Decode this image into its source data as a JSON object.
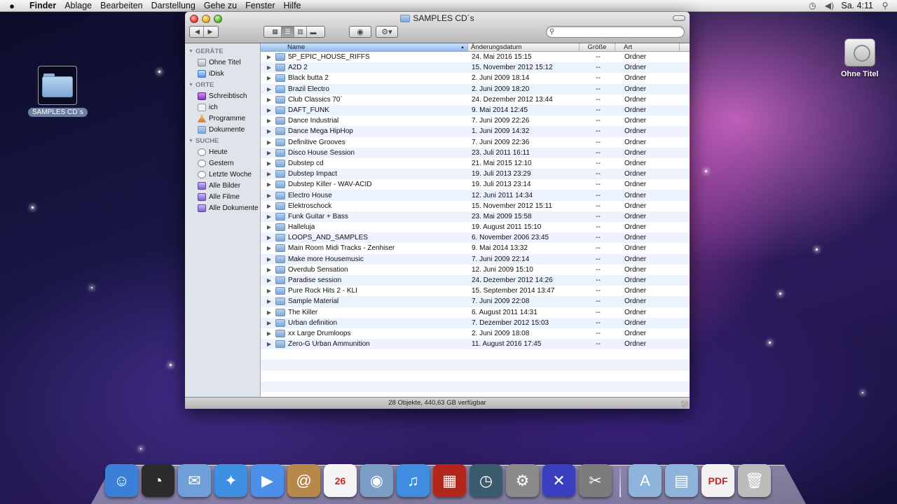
{
  "menubar": {
    "app_name": "Finder",
    "menus": [
      "Ablage",
      "Bearbeiten",
      "Darstellung",
      "Gehe zu",
      "Fenster",
      "Hilfe"
    ],
    "clock": "Sa. 4:11"
  },
  "desktop": {
    "folder_label": "SAMPLES CD´s",
    "disk_label": "Ohne Titel"
  },
  "window": {
    "title": "SAMPLES CD´s",
    "search": {
      "value": "",
      "placeholder": ""
    },
    "status": "28 Objekte, 440,63 GB verfügbar"
  },
  "sidebar": {
    "sections": [
      {
        "title": "GERÄTE",
        "items": [
          {
            "label": "Ohne Titel",
            "icon": "disk-icon"
          },
          {
            "label": "iDisk",
            "icon": "idisk-icon"
          }
        ]
      },
      {
        "title": "ORTE",
        "items": [
          {
            "label": "Schreibtisch",
            "icon": "desktop-icon"
          },
          {
            "label": "ich",
            "icon": "home-icon"
          },
          {
            "label": "Programme",
            "icon": "applications-icon"
          },
          {
            "label": "Dokumente",
            "icon": "documents-icon"
          }
        ]
      },
      {
        "title": "SUCHE",
        "items": [
          {
            "label": "Heute",
            "icon": "clock-icon"
          },
          {
            "label": "Gestern",
            "icon": "clock-icon"
          },
          {
            "label": "Letzte Woche",
            "icon": "clock-icon"
          },
          {
            "label": "Alle Bilder",
            "icon": "smart-folder-icon"
          },
          {
            "label": "Alle Filme",
            "icon": "smart-folder-icon"
          },
          {
            "label": "Alle Dokumente",
            "icon": "smart-folder-icon"
          }
        ]
      }
    ]
  },
  "list": {
    "columns": {
      "name": "Name",
      "date": "Änderungsdatum",
      "size": "Größe",
      "kind": "Art"
    },
    "rows": [
      {
        "name": "5P_EPIC_HOUSE_RIFFS",
        "date": "24. Mai 2016 15:15",
        "size": "--",
        "kind": "Ordner"
      },
      {
        "name": "A2D 2",
        "date": "15. November 2012 15:12",
        "size": "--",
        "kind": "Ordner"
      },
      {
        "name": "Black butta 2",
        "date": "2. Juni 2009 18:14",
        "size": "--",
        "kind": "Ordner"
      },
      {
        "name": "Brazil Electro",
        "date": "2. Juni 2009 18:20",
        "size": "--",
        "kind": "Ordner"
      },
      {
        "name": "Club Classics 70´",
        "date": "24. Dezember 2012 13:44",
        "size": "--",
        "kind": "Ordner"
      },
      {
        "name": "DAFT_FUNK",
        "date": "9. Mai 2014 12:45",
        "size": "--",
        "kind": "Ordner"
      },
      {
        "name": "Dance Industrial",
        "date": "7. Juni 2009 22:26",
        "size": "--",
        "kind": "Ordner"
      },
      {
        "name": "Dance Mega HipHop",
        "date": "1. Juni 2009 14:32",
        "size": "--",
        "kind": "Ordner"
      },
      {
        "name": "Definitive Grooves",
        "date": "7. Juni 2009 22:36",
        "size": "--",
        "kind": "Ordner"
      },
      {
        "name": "Disco House Session",
        "date": "23. Juli 2011 16:11",
        "size": "--",
        "kind": "Ordner"
      },
      {
        "name": "Dubstep cd",
        "date": "21. Mai 2015 12:10",
        "size": "--",
        "kind": "Ordner"
      },
      {
        "name": "Dubstep Impact",
        "date": "19. Juli 2013 23:29",
        "size": "--",
        "kind": "Ordner"
      },
      {
        "name": "Dubstep Killer - WAV-ACID",
        "date": "19. Juli 2013 23:14",
        "size": "--",
        "kind": "Ordner"
      },
      {
        "name": "Electro House",
        "date": "12. Juni 2011 14:34",
        "size": "--",
        "kind": "Ordner"
      },
      {
        "name": "Elektroschock",
        "date": "15. November 2012 15:11",
        "size": "--",
        "kind": "Ordner"
      },
      {
        "name": "Funk Guitar + Bass",
        "date": "23. Mai 2009 15:58",
        "size": "--",
        "kind": "Ordner"
      },
      {
        "name": "Halleluja",
        "date": "19. August 2011 15:10",
        "size": "--",
        "kind": "Ordner"
      },
      {
        "name": "LOOPS_AND_SAMPLES",
        "date": "6. November 2006 23:45",
        "size": "--",
        "kind": "Ordner"
      },
      {
        "name": "Main Room Midi Tracks - Zenhiser",
        "date": "9. Mai 2014 13:32",
        "size": "--",
        "kind": "Ordner"
      },
      {
        "name": "Make  more Housemusic",
        "date": "7. Juni 2009 22:14",
        "size": "--",
        "kind": "Ordner"
      },
      {
        "name": "Overdub Sensation",
        "date": "12. Juni 2009 15:10",
        "size": "--",
        "kind": "Ordner"
      },
      {
        "name": "Paradise session",
        "date": "24. Dezember 2012 14:26",
        "size": "--",
        "kind": "Ordner"
      },
      {
        "name": "Pure Rock Hits 2 - KLI",
        "date": "15. September 2014 13:47",
        "size": "--",
        "kind": "Ordner"
      },
      {
        "name": "Sample Material",
        "date": "7. Juni 2009 22:08",
        "size": "--",
        "kind": "Ordner"
      },
      {
        "name": "The Killer",
        "date": "6. August 2011 14:31",
        "size": "--",
        "kind": "Ordner"
      },
      {
        "name": "Urban definition",
        "date": "7. Dezember 2012 15:03",
        "size": "--",
        "kind": "Ordner"
      },
      {
        "name": "xx Large Drumloops",
        "date": "2. Juni 2009 18:08",
        "size": "--",
        "kind": "Ordner"
      },
      {
        "name": "Zero-G Urban Ammunition",
        "date": "11. August 2016 17:45",
        "size": "--",
        "kind": "Ordner"
      }
    ]
  },
  "dock": {
    "apps": [
      {
        "icon": "finder-icon",
        "glyph": "☺",
        "color": "#3c7fd6"
      },
      {
        "icon": "dashboard-icon",
        "glyph": "◔",
        "color": "#2b2b2b"
      },
      {
        "icon": "mail-icon",
        "glyph": "✉",
        "color": "#6f9fd8"
      },
      {
        "icon": "safari-icon",
        "glyph": "✦",
        "color": "#3d8fe0"
      },
      {
        "icon": "ichat-icon",
        "glyph": "▶",
        "color": "#4b8fe8"
      },
      {
        "icon": "address-book-icon",
        "glyph": "@",
        "color": "#b8874a"
      },
      {
        "icon": "ical-icon",
        "glyph": "26",
        "color": "#f4f4f4"
      },
      {
        "icon": "iphoto-icon",
        "glyph": "◉",
        "color": "#7a9ec4"
      },
      {
        "icon": "itunes-icon",
        "glyph": "♫",
        "color": "#3e8de0"
      },
      {
        "icon": "photo-booth-icon",
        "glyph": "▦",
        "color": "#b3261c"
      },
      {
        "icon": "time-machine-icon",
        "glyph": "◷",
        "color": "#3a5a6e"
      },
      {
        "icon": "system-preferences-icon",
        "glyph": "⚙",
        "color": "#8a8a8a"
      },
      {
        "icon": "vise-icon",
        "glyph": "✕",
        "color": "#3b3fbf"
      },
      {
        "icon": "utility-icon",
        "glyph": "✂",
        "color": "#7c7c7c"
      }
    ],
    "stacks": [
      {
        "icon": "applications-stack-icon",
        "glyph": "A",
        "color": "#8fb4dc"
      },
      {
        "icon": "documents-stack-icon",
        "glyph": "▤",
        "color": "#8fb4dc"
      },
      {
        "icon": "pdf-document-icon",
        "glyph": "PDF",
        "color": "#f2f2f2"
      },
      {
        "icon": "trash-icon",
        "glyph": "🗑",
        "color": "#bcbcbc"
      }
    ]
  }
}
